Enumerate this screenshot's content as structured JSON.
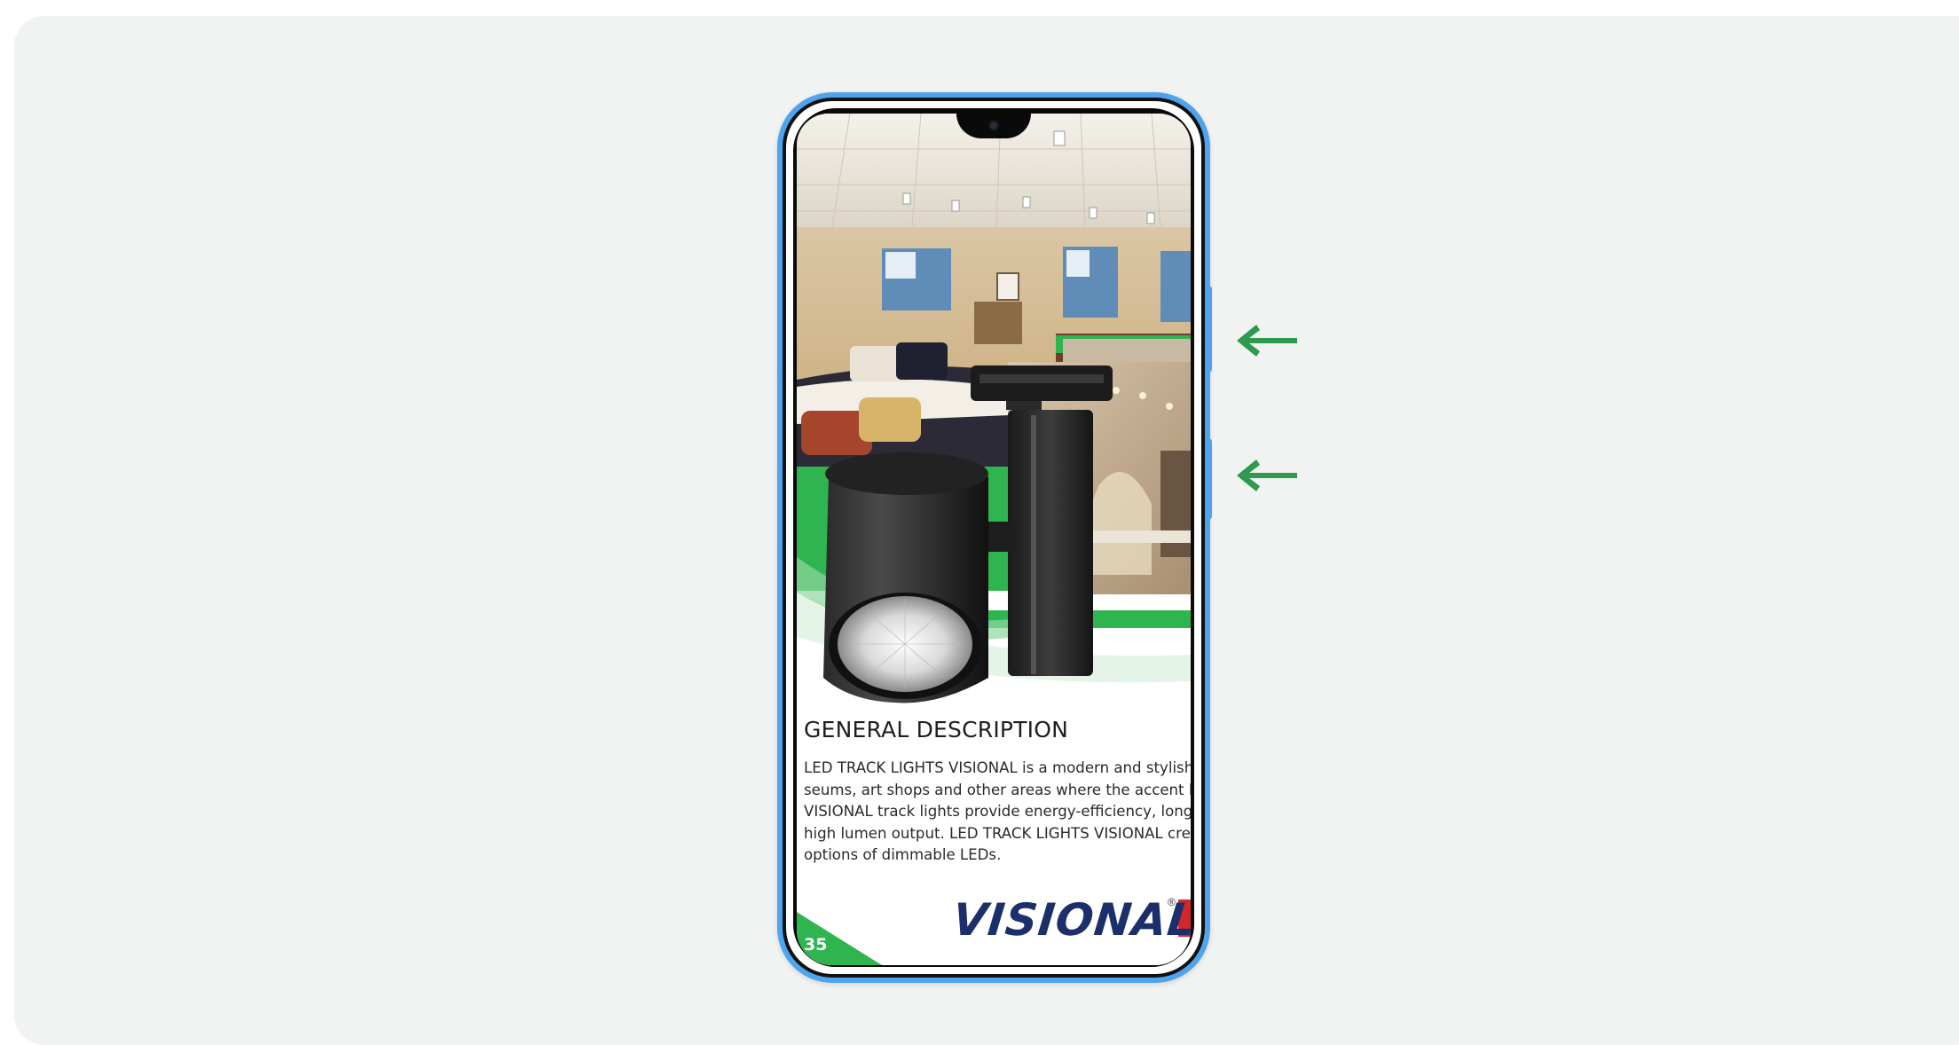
{
  "page": {
    "heading": "GENERAL DESCRIPTION",
    "description_lines": [
      "LED TRACK LIGHTS VISIONAL is a modern and stylish",
      "seums, art shops and other areas where the accent li",
      "VISIONAL track lights provide energy-efficiency, long",
      "high lumen output. LED TRACK LIGHTS VISIONAL crea",
      "options of dimmable LEDs."
    ],
    "brand": "VISIONAL",
    "brand_registered_mark": "®",
    "page_number": "35"
  },
  "arrows": [
    {
      "direction": "left",
      "points_to": "side-button-upper"
    },
    {
      "direction": "left",
      "points_to": "side-button-lower"
    }
  ],
  "colors": {
    "phone_outline": "#4ea4ee",
    "accent_green": "#2fb550",
    "arrow_green": "#2e9a4e",
    "brand_navy": "#1d2f6b",
    "brand_red": "#d1282e",
    "background": "#f1f2f2"
  }
}
